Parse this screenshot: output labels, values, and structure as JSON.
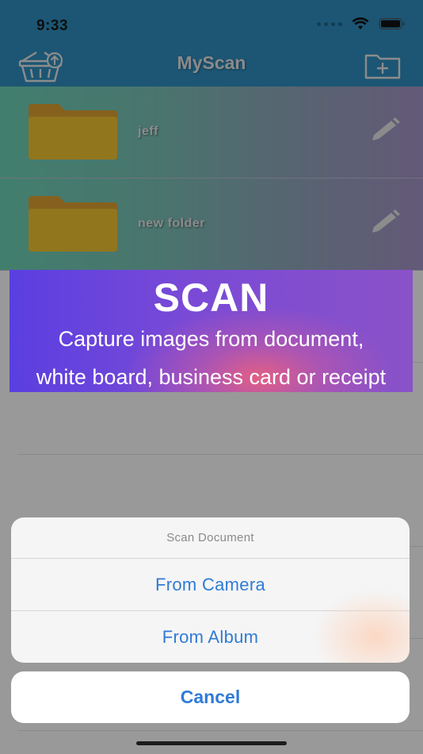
{
  "status_bar": {
    "time": "9:33"
  },
  "navbar": {
    "title": "MyScan"
  },
  "folders": [
    {
      "name": "jeff"
    },
    {
      "name": "new folder"
    }
  ],
  "banner": {
    "title": "SCAN",
    "line1": "Capture images from document,",
    "line2": "white board, business card or receipt"
  },
  "action_sheet": {
    "title": "Scan Document",
    "options": [
      "From Camera",
      "From Album"
    ],
    "cancel_label": "Cancel"
  },
  "colors": {
    "navbar": "#2f8fc2",
    "action_blue": "#2f7bd6",
    "folder_yellow": "#f2c531"
  }
}
